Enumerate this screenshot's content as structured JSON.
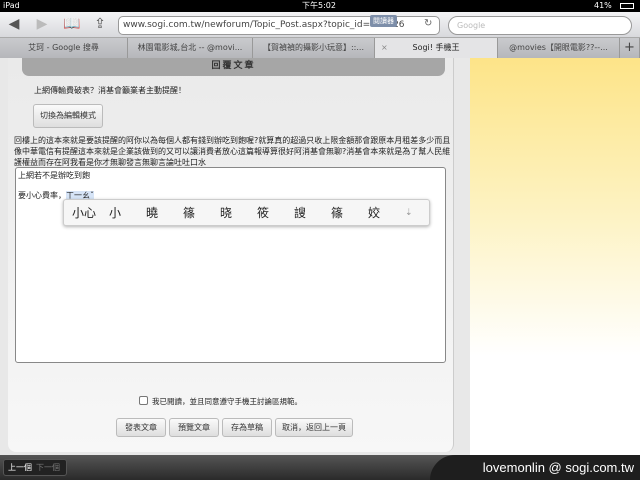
{
  "status": {
    "device": "iPad",
    "time": "下午5:02",
    "battery": "41%"
  },
  "browser": {
    "url": "www.sogi.com.tw/newforum/Topic_Post.aspx?topic_id=617626",
    "reader": "閱讀器",
    "search_placeholder": "Google",
    "tabs": [
      "艾珂 - Google 搜尋",
      "林園電影城,台北 -- @movi...",
      "【賀禎禎的攝影小玩意】::...",
      "Sogi! 手機王",
      "@movies【開眼電影??--..."
    ],
    "new_tab": "+",
    "close": "×"
  },
  "page": {
    "header": "回覆文章",
    "topic_title": "上網傳輸費破表？消基會籲業者主動提醒！",
    "switch_mode": "切換為編輯模式",
    "quote": "回樓上的這本來就是要該提醒的阿你以為每個人都有錢到辦吃到飽喔?就算真的超過只收上限金額那會跟原本月租差多少而且像中華電信有提醒這本來就是企業該做到的又可以讓消費者放心這篇報導算很好阿消基會無聊?消基會本來就是為了幫人民維護權益而存在阿我看是你才無聊發言無聊言論吐吐口水",
    "editor_line1": "上網若不是辦吃到飽",
    "editor_line2": "要小心費率，",
    "composing": "ㄒ一ㄠˇ",
    "candidates": [
      "小心",
      "小",
      "曉",
      "篠",
      "晓",
      "筱",
      "謏",
      "篠",
      "姣"
    ],
    "agree": "我已閱讀，並且同意遵守手機王討論區規範。",
    "buttons": [
      "發表文章",
      "預覽文章",
      "存為草稿",
      "取消，返回上一頁"
    ]
  },
  "bottom": {
    "prev": "上一個",
    "next": "下一個",
    "watermark": "lovemonlin  @ sogi.com.tw"
  }
}
